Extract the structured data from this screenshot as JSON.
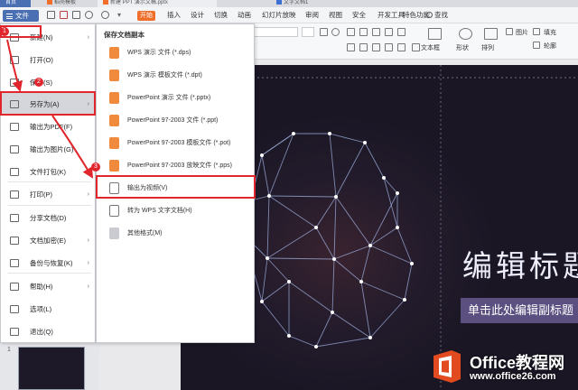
{
  "tabs": [
    {
      "label": "首页",
      "color": "#ffffff"
    },
    {
      "label": "稻壳模板",
      "color": "#f06e2a"
    },
    {
      "label": "新建 PPT 演示文稿.pptx",
      "color": "#f06e2a"
    },
    {
      "label": "文字文档1",
      "color": "#3b6fd1"
    }
  ],
  "menubar": {
    "file_label": "文件",
    "start_label": "开始",
    "tabs": [
      "插入",
      "设计",
      "切换",
      "动画",
      "幻灯片放映",
      "审阅",
      "视图",
      "安全",
      "开发工具",
      "特色功能"
    ],
    "search_label": "查找"
  },
  "toolbar": {
    "textbox_label": "文本框",
    "shape_label": "形状",
    "arrange_label": "排列",
    "fill_label": "填充",
    "outline_label": "轮廓",
    "image_label": "图片"
  },
  "file_menu": [
    {
      "label": "新建(N)",
      "icon": "new-file-icon",
      "arrow": true
    },
    {
      "label": "打开(O)",
      "icon": "open-folder-icon",
      "arrow": false
    },
    {
      "label": "保存(S)",
      "icon": "save-icon",
      "arrow": false
    },
    {
      "label": "另存为(A)",
      "icon": "save-as-icon",
      "arrow": true
    },
    {
      "label": "输出为PDF(F)",
      "icon": "pdf-icon",
      "arrow": false
    },
    {
      "label": "输出为图片(G)",
      "icon": "image-export-icon",
      "arrow": false
    },
    {
      "label": "文件打包(K)",
      "icon": "package-icon",
      "arrow": true
    },
    {
      "label": "打印(P)",
      "icon": "print-icon",
      "arrow": true
    },
    {
      "label": "分享文档(D)",
      "icon": "share-icon",
      "arrow": false
    },
    {
      "label": "文档加密(E)",
      "icon": "encrypt-icon",
      "arrow": true
    },
    {
      "label": "备份与恢复(K)",
      "icon": "backup-icon",
      "arrow": true
    },
    {
      "label": "帮助(H)",
      "icon": "help-icon",
      "arrow": true
    },
    {
      "label": "选项(L)",
      "icon": "settings-icon",
      "arrow": false
    },
    {
      "label": "退出(Q)",
      "icon": "exit-icon",
      "arrow": false
    }
  ],
  "submenu": {
    "heading": "保存文档副本",
    "items": [
      {
        "label": "WPS 演示 文件 (*.dps)",
        "icon": "dps-file-icon"
      },
      {
        "label": "WPS 演示 模板文件 (*.dpt)",
        "icon": "dpt-file-icon"
      },
      {
        "label": "PowerPoint 演示 文件 (*.pptx)",
        "icon": "pptx-file-icon"
      },
      {
        "label": "PowerPoint 97-2003 文件 (*.ppt)",
        "icon": "ppt-file-icon"
      },
      {
        "label": "PowerPoint 97-2003 模板文件 (*.pot)",
        "icon": "pot-file-icon"
      },
      {
        "label": "PowerPoint 97-2003 放映文件 (*.pps)",
        "icon": "pps-file-icon"
      },
      {
        "label": "输出为视频(V)",
        "icon": "video-export-icon"
      },
      {
        "label": "转为 WPS 文字文档(H)",
        "icon": "wps-writer-icon"
      },
      {
        "label": "其他格式(M)",
        "icon": "other-format-icon"
      }
    ]
  },
  "annotations": [
    "1",
    "2",
    "3"
  ],
  "slide": {
    "title": "编辑标题",
    "subtitle": "单击此处编辑副标题"
  },
  "thumbnail": {
    "number": "1"
  },
  "watermark": {
    "title": "Office教程网",
    "url": "www.office26.com"
  },
  "colors": {
    "accent_blue": "#4a6fb2",
    "orange": "#f06e2a",
    "annotation_red": "#e0262c",
    "slide_bg": "#221b2b"
  }
}
